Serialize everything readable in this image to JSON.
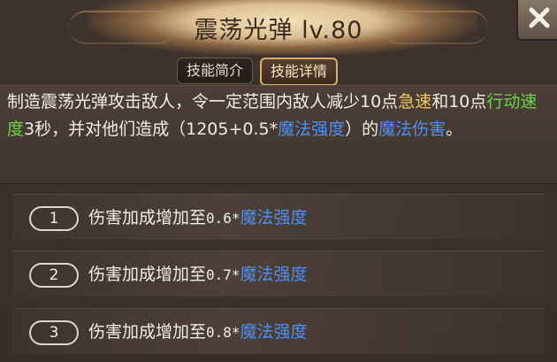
{
  "header": {
    "title": "震荡光弹 lv.80"
  },
  "tabs": [
    {
      "label": "技能简介",
      "active": false
    },
    {
      "label": "技能详情",
      "active": true
    }
  ],
  "description": {
    "segments": [
      {
        "text": "制造震荡光弹攻击敌人，令一定范围内敌人减少10点",
        "color": "white"
      },
      {
        "text": "急速",
        "color": "yellow"
      },
      {
        "text": "和10点",
        "color": "white"
      },
      {
        "text": "行动速度",
        "color": "green"
      },
      {
        "text": "3秒，并对他们造成（1205+0.5*",
        "color": "white"
      },
      {
        "text": "魔法强度",
        "color": "blue"
      },
      {
        "text": "）的",
        "color": "white"
      },
      {
        "text": "魔法伤害",
        "color": "blue"
      },
      {
        "text": "。",
        "color": "white"
      }
    ]
  },
  "upgrades": [
    {
      "level": "1",
      "prefix": "伤害加成增加至",
      "value": "0.6*",
      "stat": "魔法强度"
    },
    {
      "level": "2",
      "prefix": "伤害加成增加至",
      "value": "0.7*",
      "stat": "魔法强度"
    },
    {
      "level": "3",
      "prefix": "伤害加成增加至",
      "value": "0.8*",
      "stat": "魔法强度"
    }
  ],
  "colors": {
    "yellow": "#f4c95a",
    "blue": "#4f8ff0",
    "green": "#6fd34a",
    "active_tab_border": "#d8b06a"
  },
  "icons": {
    "close": "close-x-icon"
  }
}
